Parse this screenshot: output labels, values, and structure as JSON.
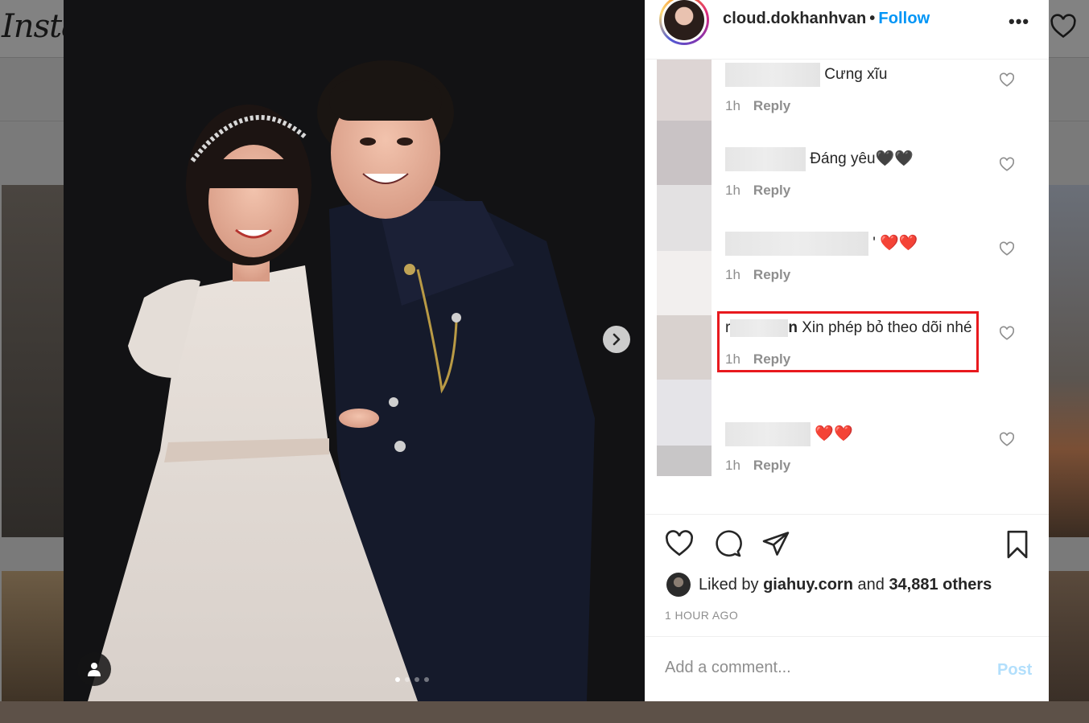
{
  "background": {
    "logo": "Insta"
  },
  "post": {
    "username": "cloud.dokhanhvan",
    "follow_label": "Follow",
    "more_label": "•••",
    "carousel": {
      "total": 4,
      "active": 1
    }
  },
  "comments": [
    {
      "text": "Cưng xĩu",
      "time": "1h",
      "reply": "Reply"
    },
    {
      "text": "Đáng yêu🖤🖤",
      "time": "1h",
      "reply": "Reply"
    },
    {
      "text": "' ❤️❤️",
      "time": "1h",
      "reply": "Reply"
    },
    {
      "prefix": "r",
      "suffix": "n",
      "text": "Xin phép bỏ theo dõi nhé",
      "time": "1h",
      "reply": "Reply"
    },
    {
      "text": "❤️❤️",
      "time": "1h",
      "reply": "Reply"
    }
  ],
  "likes": {
    "prefix": "Liked by",
    "user": "giahuy.corn",
    "joiner": "and",
    "others": "34,881 others"
  },
  "time_ago": "1 HOUR AGO",
  "add_comment": {
    "placeholder": "Add a comment...",
    "post_label": "Post"
  },
  "colors": {
    "follow": "#0095f6",
    "highlight_box": "#e8191e",
    "post_disabled": "#b2dffc"
  }
}
